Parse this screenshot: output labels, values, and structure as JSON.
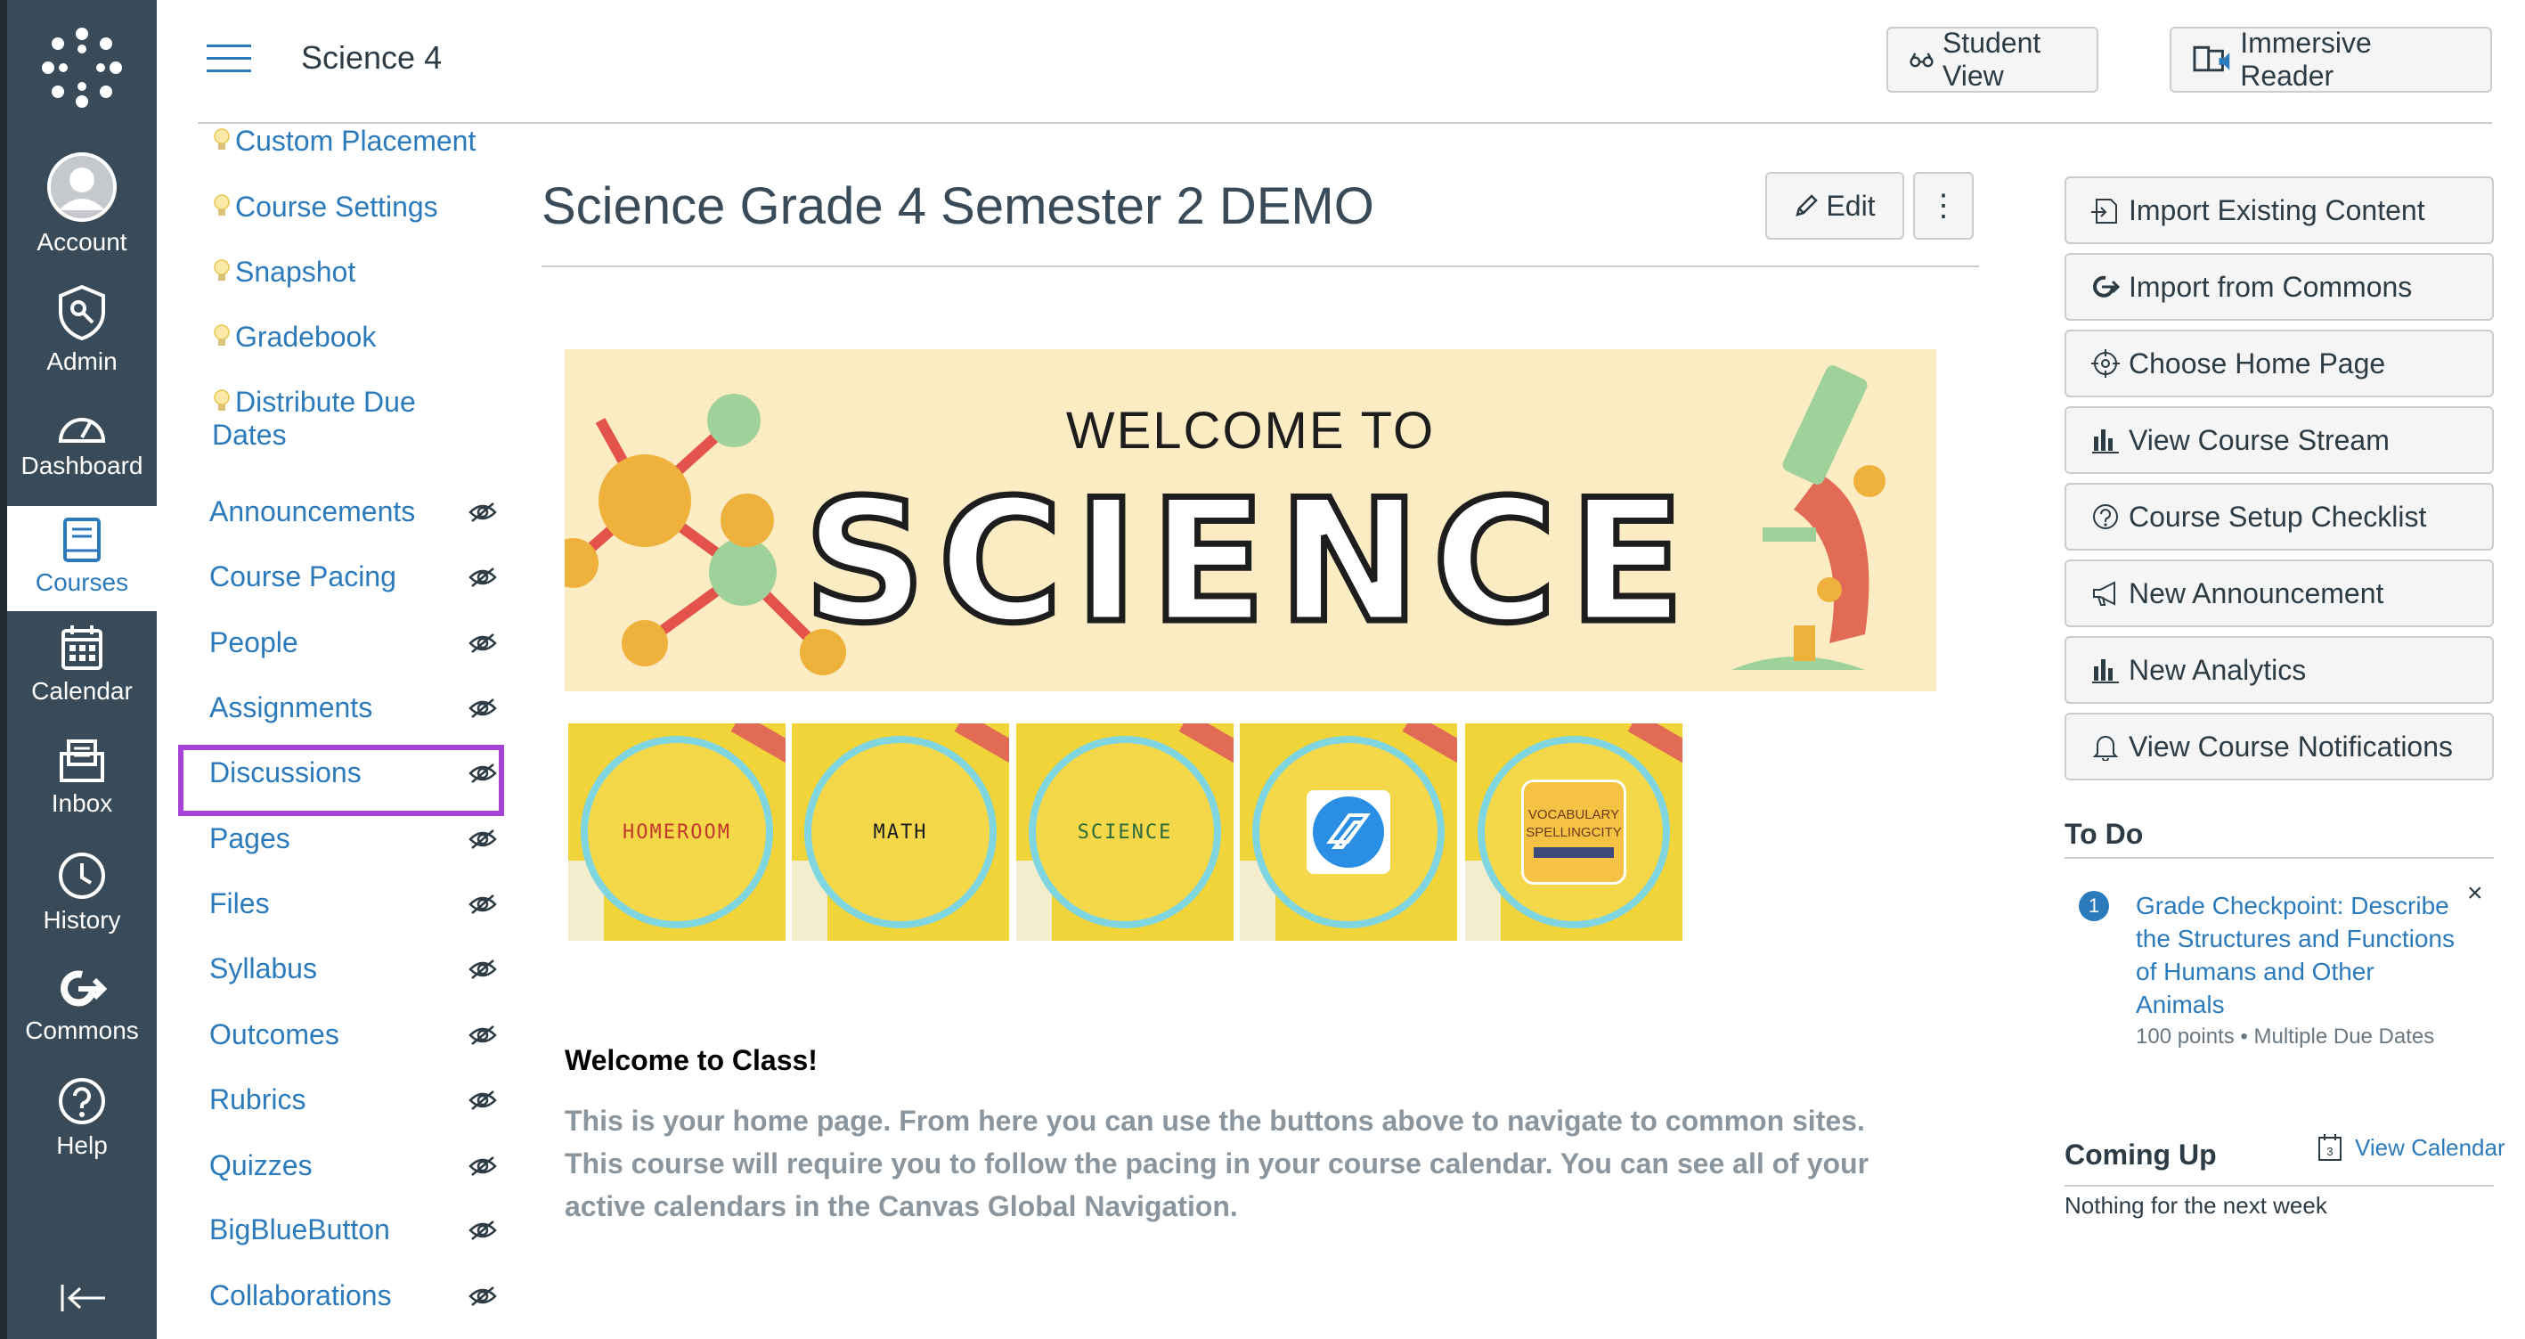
{
  "global_nav": {
    "items": [
      {
        "key": "account",
        "label": "Account"
      },
      {
        "key": "admin",
        "label": "Admin"
      },
      {
        "key": "dashboard",
        "label": "Dashboard"
      },
      {
        "key": "courses",
        "label": "Courses"
      },
      {
        "key": "calendar",
        "label": "Calendar"
      },
      {
        "key": "inbox",
        "label": "Inbox"
      },
      {
        "key": "history",
        "label": "History"
      },
      {
        "key": "commons",
        "label": "Commons"
      },
      {
        "key": "help",
        "label": "Help"
      }
    ],
    "active": "courses"
  },
  "header": {
    "course_name": "Science 4",
    "student_view_label": "Student View",
    "immersive_reader_label": "Immersive Reader"
  },
  "course_nav": {
    "items": [
      {
        "label": "Custom Placement",
        "bulb": true,
        "hidden_icon": false
      },
      {
        "label": "Course Settings",
        "bulb": true,
        "hidden_icon": false
      },
      {
        "label": "Snapshot",
        "bulb": true,
        "hidden_icon": false
      },
      {
        "label": "Gradebook",
        "bulb": true,
        "hidden_icon": false
      },
      {
        "label": "Distribute Due",
        "label2": "Dates",
        "bulb": true,
        "hidden_icon": false
      },
      {
        "label": "Announcements",
        "bulb": false,
        "hidden_icon": true
      },
      {
        "label": "Course Pacing",
        "bulb": false,
        "hidden_icon": true
      },
      {
        "label": "People",
        "bulb": false,
        "hidden_icon": true
      },
      {
        "label": "Assignments",
        "bulb": false,
        "hidden_icon": true
      },
      {
        "label": "Discussions",
        "bulb": false,
        "hidden_icon": true,
        "highlighted": true
      },
      {
        "label": "Pages",
        "bulb": false,
        "hidden_icon": true
      },
      {
        "label": "Files",
        "bulb": false,
        "hidden_icon": true
      },
      {
        "label": "Syllabus",
        "bulb": false,
        "hidden_icon": true
      },
      {
        "label": "Outcomes",
        "bulb": false,
        "hidden_icon": true
      },
      {
        "label": "Rubrics",
        "bulb": false,
        "hidden_icon": true
      },
      {
        "label": "Quizzes",
        "bulb": false,
        "hidden_icon": true
      },
      {
        "label": "BigBlueButton",
        "bulb": false,
        "hidden_icon": true
      },
      {
        "label": "Collaborations",
        "bulb": false,
        "hidden_icon": true
      }
    ],
    "highlight_color": "#a742d6"
  },
  "main": {
    "title": "Science Grade 4 Semester 2 DEMO",
    "edit_label": "Edit",
    "more_label": "⋮",
    "banner": {
      "line1": "WELCOME TO",
      "line2": "SCIENCE"
    },
    "tiles": [
      {
        "label": "HOMEROOM",
        "color": "#c0392b"
      },
      {
        "label": "MATH",
        "color": "#1d1d1d"
      },
      {
        "label": "SCIENCE",
        "color": "#2e6b3a"
      },
      {
        "label": "",
        "logo": "nearpod-logo-icon"
      },
      {
        "label": "",
        "logo": "vocabulary-spellingcity-logo-icon",
        "logo_text1": "VOCABULARY",
        "logo_text2": "SPELLINGCITY"
      }
    ],
    "welcome_heading": "Welcome to Class!",
    "welcome_body": "This is your home page. From here you can use the buttons above to navigate to common sites. This course will require you to follow the pacing in your course calendar. You can see all of your active calendars in the Canvas Global Navigation."
  },
  "sidebar": {
    "buttons": [
      {
        "label": "Import Existing Content",
        "icon": "import-icon"
      },
      {
        "label": "Import from Commons",
        "icon": "commons-icon"
      },
      {
        "label": "Choose Home Page",
        "icon": "target-icon"
      },
      {
        "label": "View Course Stream",
        "icon": "bar-chart-icon"
      },
      {
        "label": "Course Setup Checklist",
        "icon": "question-icon"
      },
      {
        "label": "New Announcement",
        "icon": "megaphone-icon"
      },
      {
        "label": "New Analytics",
        "icon": "bar-chart-icon"
      },
      {
        "label": "View Course Notifications",
        "icon": "bell-icon"
      }
    ],
    "todo": {
      "heading": "To Do",
      "badge": "1",
      "title": "Grade Checkpoint: Describe the Structures and Functions of Humans and Other Animals",
      "meta": "100 points • Multiple Due Dates",
      "close": "×"
    },
    "coming_up": {
      "heading": "Coming Up",
      "view_calendar": "View Calendar",
      "calendar_day": "3",
      "empty": "Nothing for the next week"
    }
  },
  "colors": {
    "nav_bg": "#394b58",
    "link": "#2b7abc",
    "text": "#2d3b45",
    "button_bg": "#f5f5f5"
  }
}
